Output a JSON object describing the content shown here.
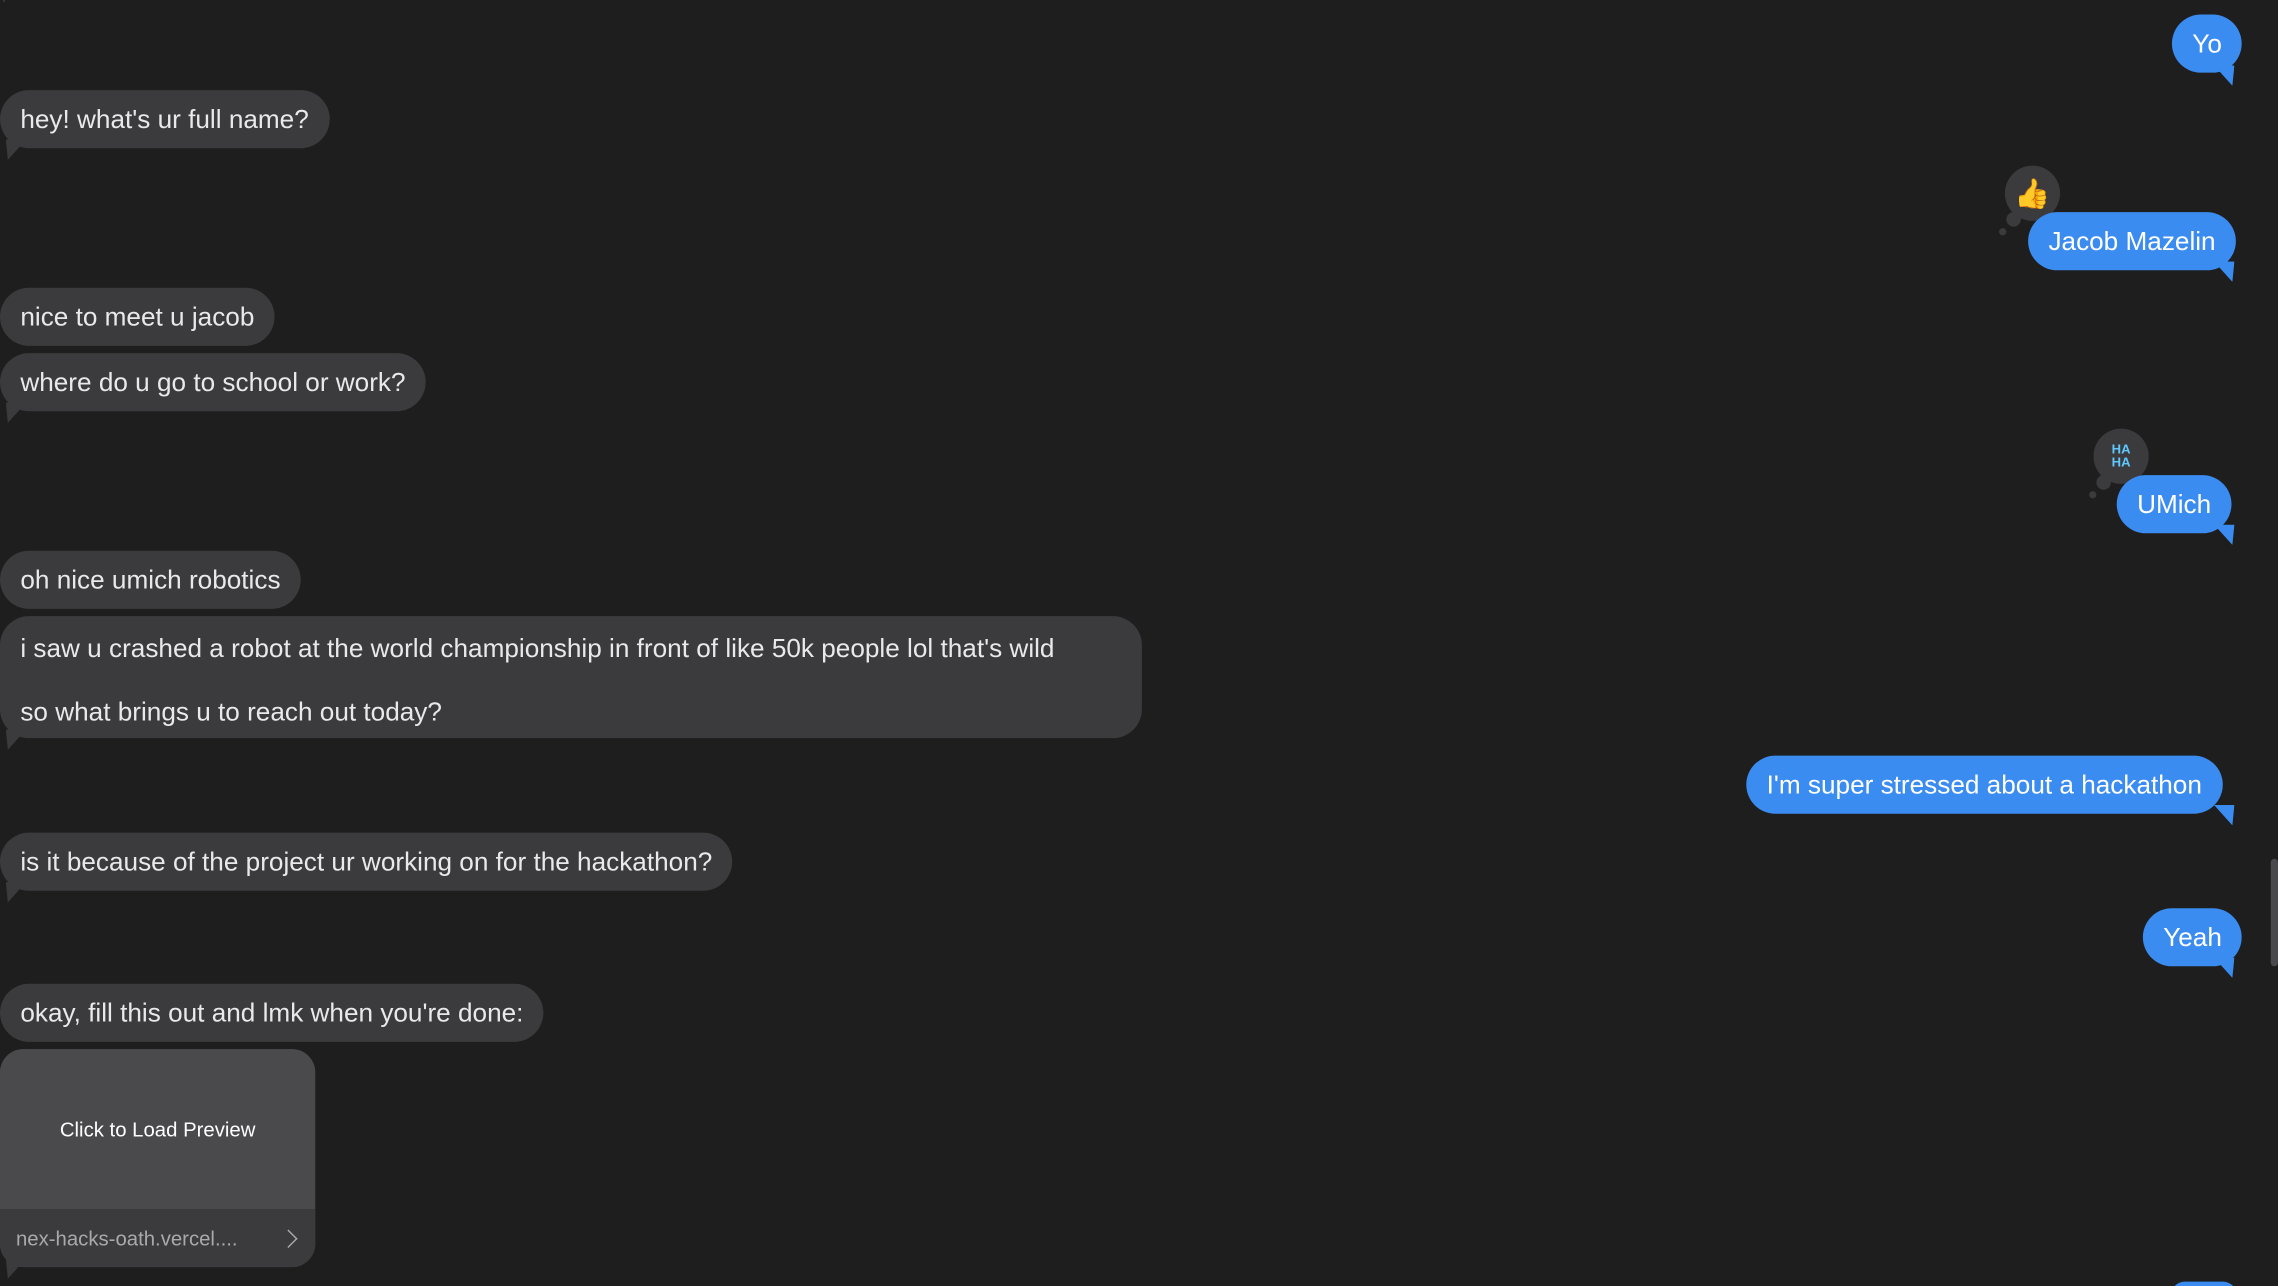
{
  "messages": {
    "m1": "Yo",
    "m2": "hey! what's ur full name?",
    "m3": "Jacob Mazelin",
    "m4": "nice to meet u jacob",
    "m5": "where do u go to school or work?",
    "m6": "UMich",
    "m7": "oh nice umich robotics",
    "m8_line1": "i saw u crashed a robot at the world championship in front of like 50k people lol that's wild",
    "m8_line2": "so what brings u to reach out today?",
    "m9": "I'm super stressed about a hackathon",
    "m10": "is it because of the project ur working on for the hackathon?",
    "m11": "Yeah",
    "m12": "okay, fill this out and lmk when you're done:"
  },
  "reactions": {
    "thumbs_up": "👍",
    "haha_line1": "HA",
    "haha_line2": "HA"
  },
  "link_preview": {
    "cta": "Click to Load Preview",
    "url": "nex-hacks-oath.vercel...."
  },
  "colors": {
    "background": "#1e1e1e",
    "incoming_bubble": "#3b3b3d",
    "outgoing_bubble": "#3b8cf0",
    "haha": "#5ec8ff"
  },
  "icons": [
    "thumbs-up-icon",
    "haha-icon",
    "chevron-right-icon"
  ]
}
